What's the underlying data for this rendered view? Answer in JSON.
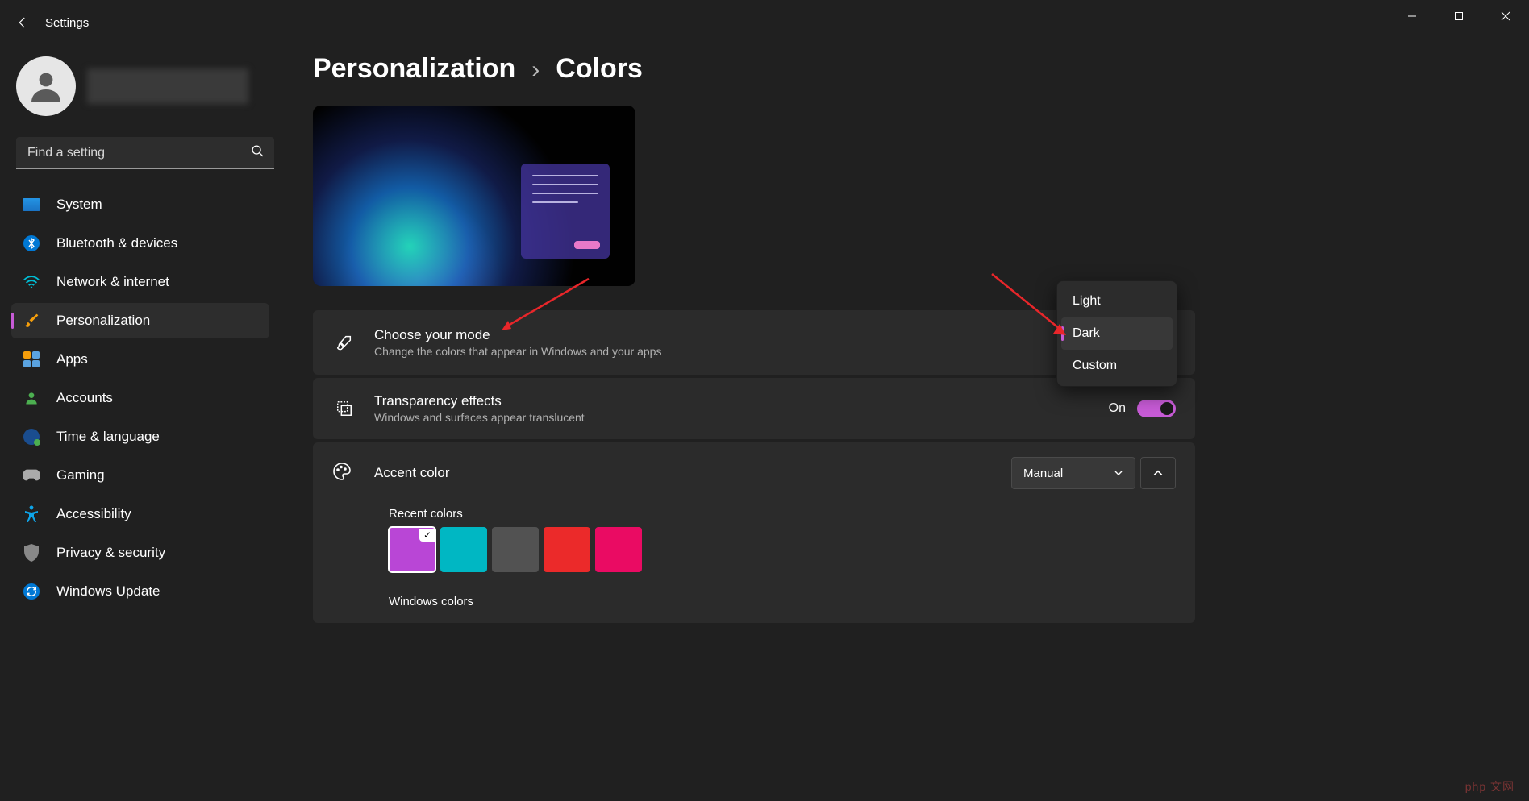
{
  "window": {
    "title": "Settings"
  },
  "search": {
    "placeholder": "Find a setting"
  },
  "nav": {
    "system": "System",
    "bluetooth": "Bluetooth & devices",
    "network": "Network & internet",
    "personalization": "Personalization",
    "apps": "Apps",
    "accounts": "Accounts",
    "time": "Time & language",
    "gaming": "Gaming",
    "accessibility": "Accessibility",
    "privacy": "Privacy & security",
    "update": "Windows Update"
  },
  "breadcrumb": {
    "parent": "Personalization",
    "sep": "›",
    "current": "Colors"
  },
  "settings": {
    "mode": {
      "title": "Choose your mode",
      "subtitle": "Change the colors that appear in Windows and your apps"
    },
    "transparency": {
      "title": "Transparency effects",
      "subtitle": "Windows and surfaces appear translucent",
      "state": "On"
    },
    "accent": {
      "title": "Accent color",
      "mode": "Manual"
    },
    "recent_label": "Recent colors",
    "windows_label": "Windows colors",
    "recent_swatches": [
      "#b946d6",
      "#00b7c3",
      "#525252",
      "#eb2a2a",
      "#ea0b63"
    ]
  },
  "flyout": {
    "options": {
      "light": "Light",
      "dark": "Dark",
      "custom": "Custom"
    },
    "selected": "dark"
  },
  "watermark": "php 文网"
}
